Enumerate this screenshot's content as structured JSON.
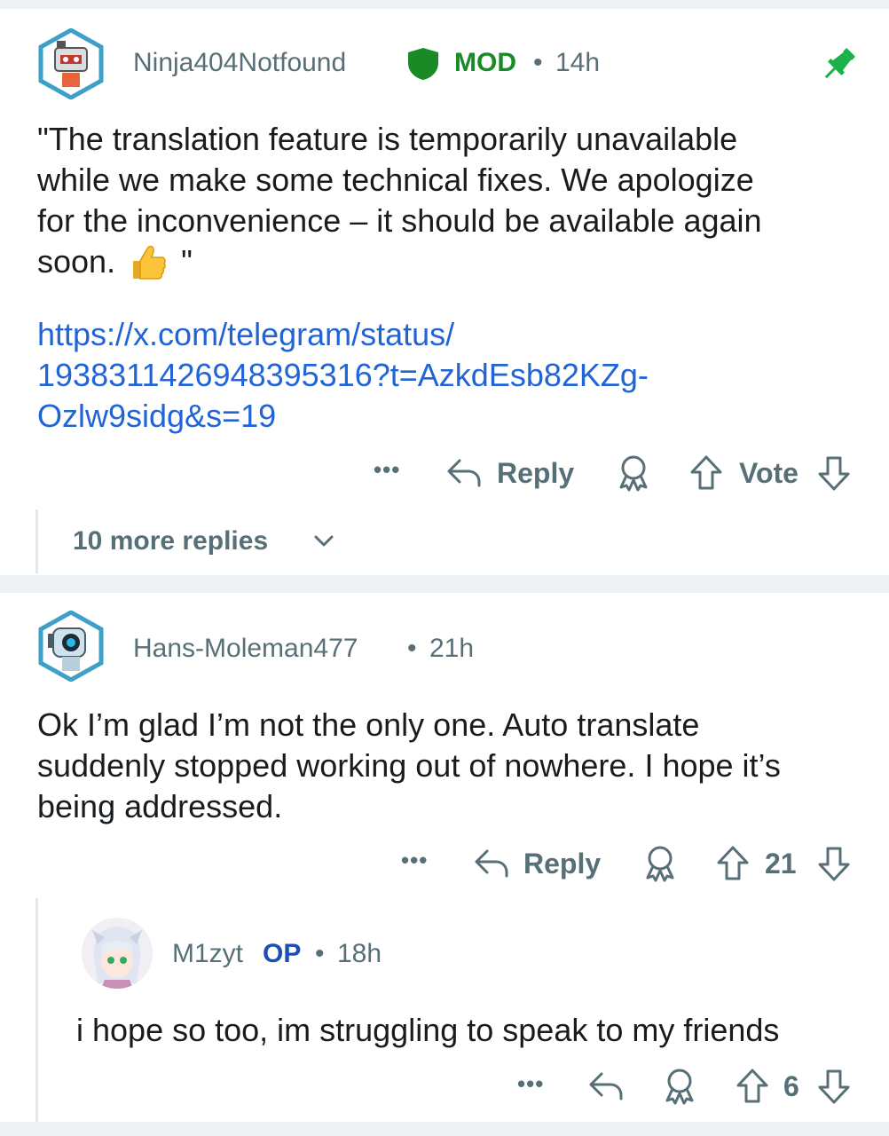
{
  "comments": [
    {
      "username": "Ninja404Notfound",
      "mod_badge": "MOD",
      "time": "14h",
      "body_lines": [
        "\"The translation feature is temporarily unavailable",
        "while we make some technical fixes. We apologize",
        "for the inconvenience – it should be available again",
        "soon."
      ],
      "quote_close": "\"",
      "link_lines": [
        "https://x.com/telegram/status/",
        "1938311426948395316?t=AzkdEsb82KZg-",
        "Ozlw9sidg&s=19"
      ],
      "more_label": "•••",
      "reply_label": "Reply",
      "vote_label": "Vote",
      "more_replies": "10 more replies"
    },
    {
      "username": "Hans-Moleman477",
      "time": "21h",
      "body_lines": [
        "Ok I’m glad I’m not the only one. Auto translate",
        "suddenly stopped working out of nowhere. I hope it’s",
        "being addressed."
      ],
      "more_label": "•••",
      "reply_label": "Reply",
      "vote_count": "21"
    },
    {
      "username": "M1zyt",
      "op_badge": "OP",
      "time": "18h",
      "body_lines": [
        "i hope so too, im struggling to speak to my friends"
      ],
      "more_label": "•••",
      "vote_count": "6"
    }
  ],
  "separator_dot": "•",
  "icons": {
    "pin": "pin-icon",
    "shield": "shield-icon",
    "thumbs_up": "thumbs-up-emoji",
    "reply": "reply-arrow-icon",
    "award": "award-icon",
    "upvote": "upvote-arrow-icon",
    "downvote": "downvote-arrow-icon",
    "chevron": "chevron-down-icon"
  },
  "colors": {
    "mod_green": "#1a8a27",
    "op_blue": "#1a4fb4",
    "link_blue": "#2164d6",
    "meta_gray": "#576f76"
  }
}
